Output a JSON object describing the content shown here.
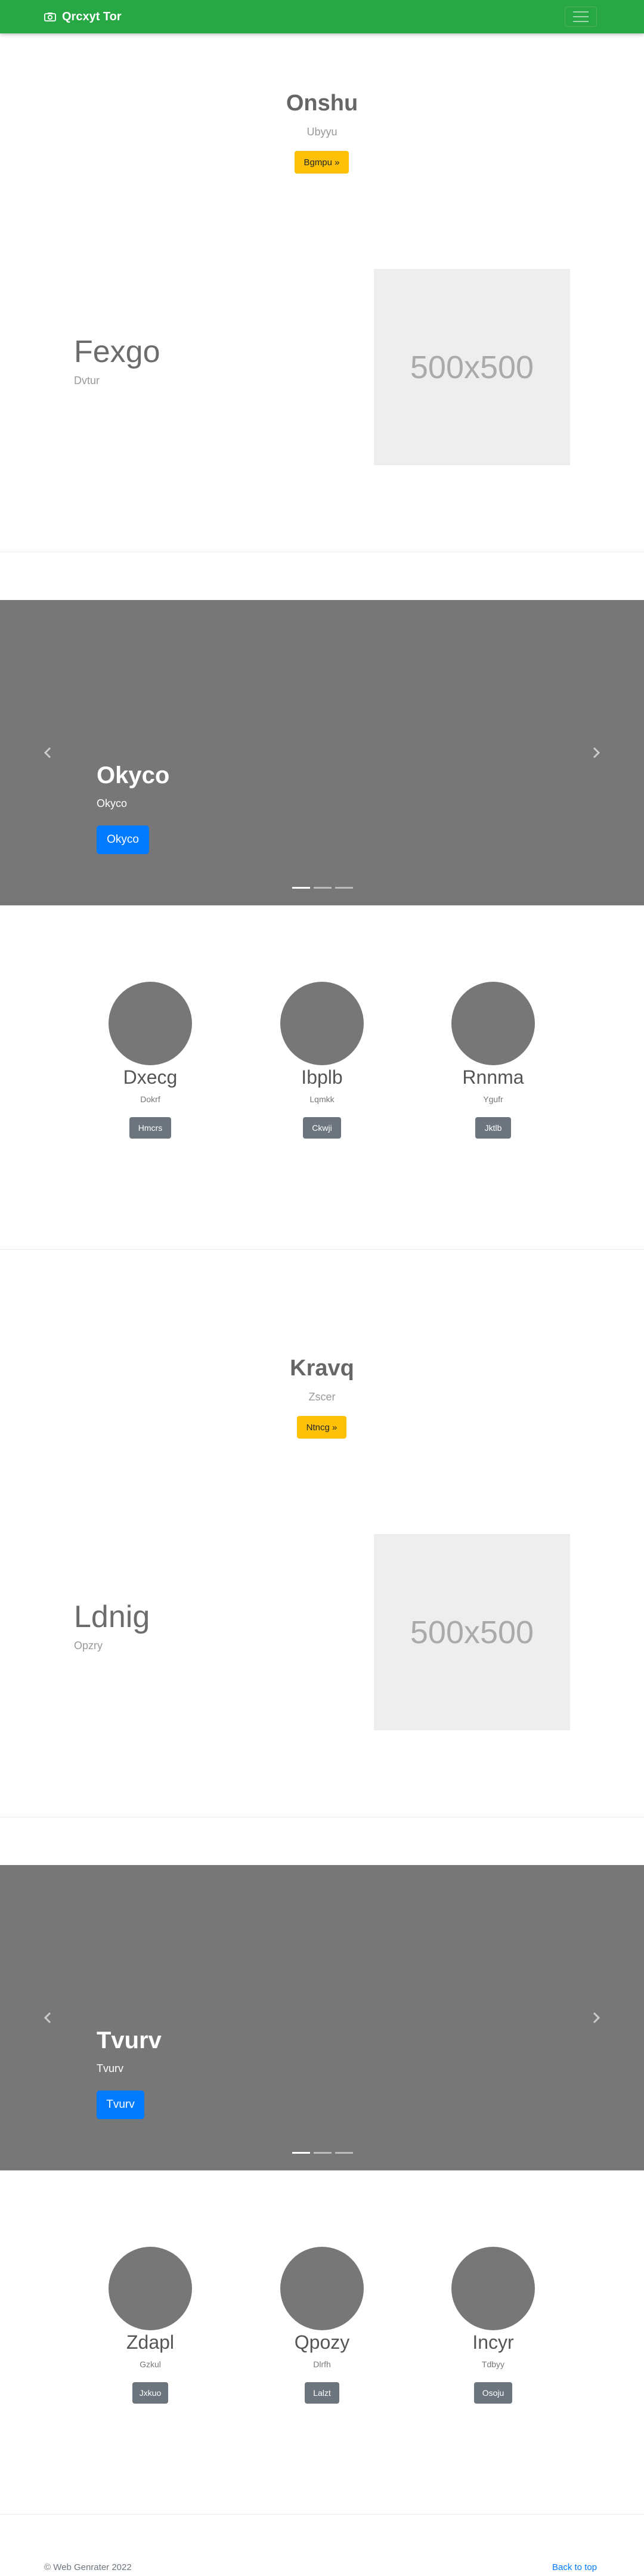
{
  "navbar": {
    "brand": "Qrcxyt Tor",
    "brand_icon": "camera-icon",
    "toggler_icon": "hamburger-icon",
    "color": "#28a745"
  },
  "section1": {
    "hero": {
      "title": "Onshu",
      "subtitle": "Ubyyu",
      "button": "Bgmpu »"
    },
    "feature": {
      "title": "Fexgo",
      "subtitle": "Dvtur",
      "image_text": "500x500"
    },
    "carousel": {
      "title": "Okyco",
      "subtitle": "Okyco",
      "button": "Okyco",
      "prev_icon": "chevron-left-icon",
      "next_icon": "chevron-right-icon",
      "slides": 3,
      "active_slide": 1
    },
    "cards": [
      {
        "name": "Dxecg",
        "subtitle": "Dokrf",
        "button": "Hmcrs"
      },
      {
        "name": "Ibplb",
        "subtitle": "Lqmkk",
        "button": "Ckwji"
      },
      {
        "name": "Rnnma",
        "subtitle": "Ygufr",
        "button": "Jktlb"
      }
    ]
  },
  "section2": {
    "hero": {
      "title": "Kravq",
      "subtitle": "Zscer",
      "button": "Ntncg »"
    },
    "feature": {
      "title": "Ldnig",
      "subtitle": "Opzry",
      "image_text": "500x500"
    },
    "carousel": {
      "title": "Tvurv",
      "subtitle": "Tvurv",
      "button": "Tvurv",
      "prev_icon": "chevron-left-icon",
      "next_icon": "chevron-right-icon",
      "slides": 3,
      "active_slide": 1
    },
    "cards": [
      {
        "name": "Zdapl",
        "subtitle": "Gzkul",
        "button": "Jxkuo"
      },
      {
        "name": "Qpozy",
        "subtitle": "Dlrfh",
        "button": "Lalzt"
      },
      {
        "name": "Incyr",
        "subtitle": "Tdbyy",
        "button": "Osoju"
      }
    ]
  },
  "footer": {
    "copyright": "© Web Genrater 2022",
    "back_to_top": "Back to top"
  }
}
